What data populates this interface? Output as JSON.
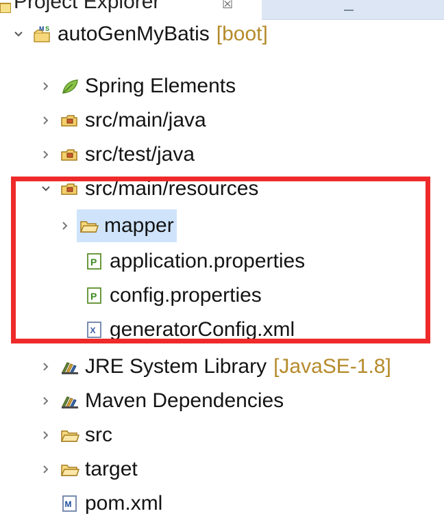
{
  "view": {
    "title": "Project Explorer",
    "close_glyph": "☒",
    "accent_color": "#dce6f4",
    "highlight_color": "#ee2a2a"
  },
  "tree": {
    "project": {
      "label": "autoGenMyBatis",
      "decoration": "[boot]",
      "icon": "maven-spring-project-icon",
      "expanded": true
    },
    "items": [
      {
        "label": "Spring Elements",
        "icon": "spring-leaf-icon",
        "expanded": false
      },
      {
        "label": "src/main/java",
        "icon": "source-folder-icon",
        "expanded": false
      },
      {
        "label": "src/test/java",
        "icon": "source-folder-icon",
        "expanded": false
      },
      {
        "label": "src/main/resources",
        "icon": "source-folder-icon",
        "expanded": true
      },
      {
        "label": "mapper",
        "icon": "folder-icon",
        "expanded": false,
        "selected": true
      },
      {
        "label": "application.properties",
        "icon": "properties-file-icon"
      },
      {
        "label": "config.properties",
        "icon": "properties-file-icon"
      },
      {
        "label": "generatorConfig.xml",
        "icon": "xml-file-icon"
      },
      {
        "label": "JRE System Library",
        "decoration": "[JavaSE-1.8]",
        "icon": "library-icon",
        "expanded": false
      },
      {
        "label": "Maven Dependencies",
        "icon": "library-icon",
        "expanded": false
      },
      {
        "label": "src",
        "icon": "folder-icon",
        "expanded": false
      },
      {
        "label": "target",
        "icon": "folder-icon",
        "expanded": false
      },
      {
        "label": "pom.xml",
        "icon": "maven-pom-file-icon"
      }
    ]
  }
}
